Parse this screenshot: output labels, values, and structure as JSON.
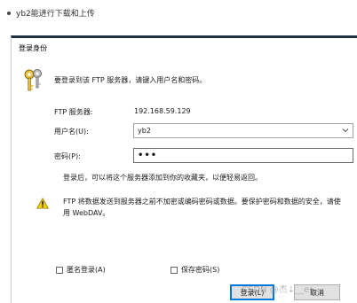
{
  "page": {
    "bullet_text": "yb2能进行下载和上传"
  },
  "dialog": {
    "title": "登录身份",
    "intro": "要登录到该 FTP 服务器，请键入用户名和密码。",
    "server_label": "FTP 服务器:",
    "server_value": "192.168.59.129",
    "username_label": "用户名(U):",
    "username_value": "yb2",
    "password_label": "密码(P):",
    "password_value": "•••",
    "hint": "登录后，可以将这个服务器添加到你的收藏夹，以便轻易返回。",
    "warning": "FTP 将数据发送到服务器之前不加密或编码密码或数据。要保护密码和数据的安全，请使用 WebDAV。",
    "anonymous_label": "匿名登录(A)",
    "save_password_label": "保存密码(S)",
    "login_button": "登录(L)",
    "cancel_button": "取消"
  },
  "watermark": "CSDN @杰↓__er"
}
